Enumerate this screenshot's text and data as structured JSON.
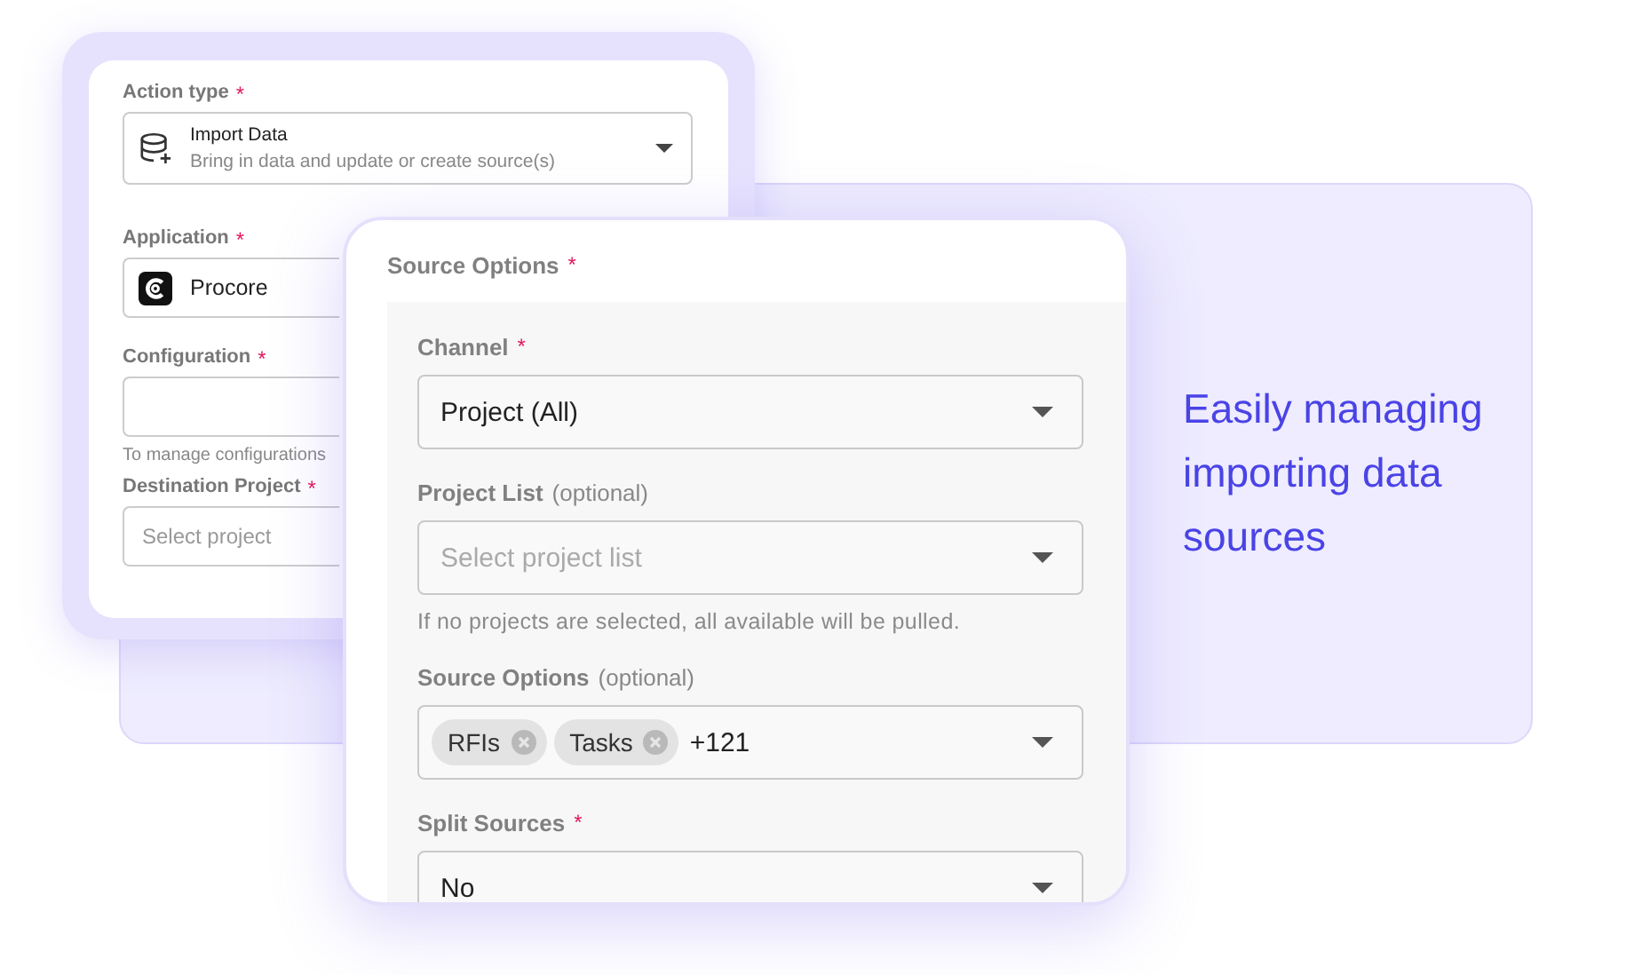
{
  "headline": "Easily managing importing data sources",
  "action_card": {
    "fields": [
      {
        "label": "Action type",
        "required_mark": "*",
        "kind": "database",
        "value": "Import Data",
        "subtitle": "Bring in data and update or create source(s)"
      },
      {
        "label": "Application",
        "required_mark": "*",
        "kind": "app",
        "value": "Procore"
      },
      {
        "label": "Configuration",
        "required_mark": "*",
        "help": "To manage configurations"
      },
      {
        "label": "Destination Project",
        "required_mark": "*",
        "placeholder": "Select project"
      }
    ]
  },
  "source_card": {
    "title": "Source Options",
    "required_mark": "*",
    "fields": [
      {
        "label": "Channel",
        "required_mark": "*",
        "value": "Project (All)"
      },
      {
        "label": "Project List",
        "note": "(optional)",
        "placeholder": "Select project list",
        "help": "If no projects are selected, all available will be pulled."
      },
      {
        "label": "Source Options",
        "note": "(optional)",
        "chips": [
          {
            "label": "RFIs"
          },
          {
            "label": "Tasks"
          }
        ],
        "more": "+121"
      },
      {
        "label": "Split Sources",
        "required_mark": "*",
        "value": "No"
      }
    ]
  }
}
